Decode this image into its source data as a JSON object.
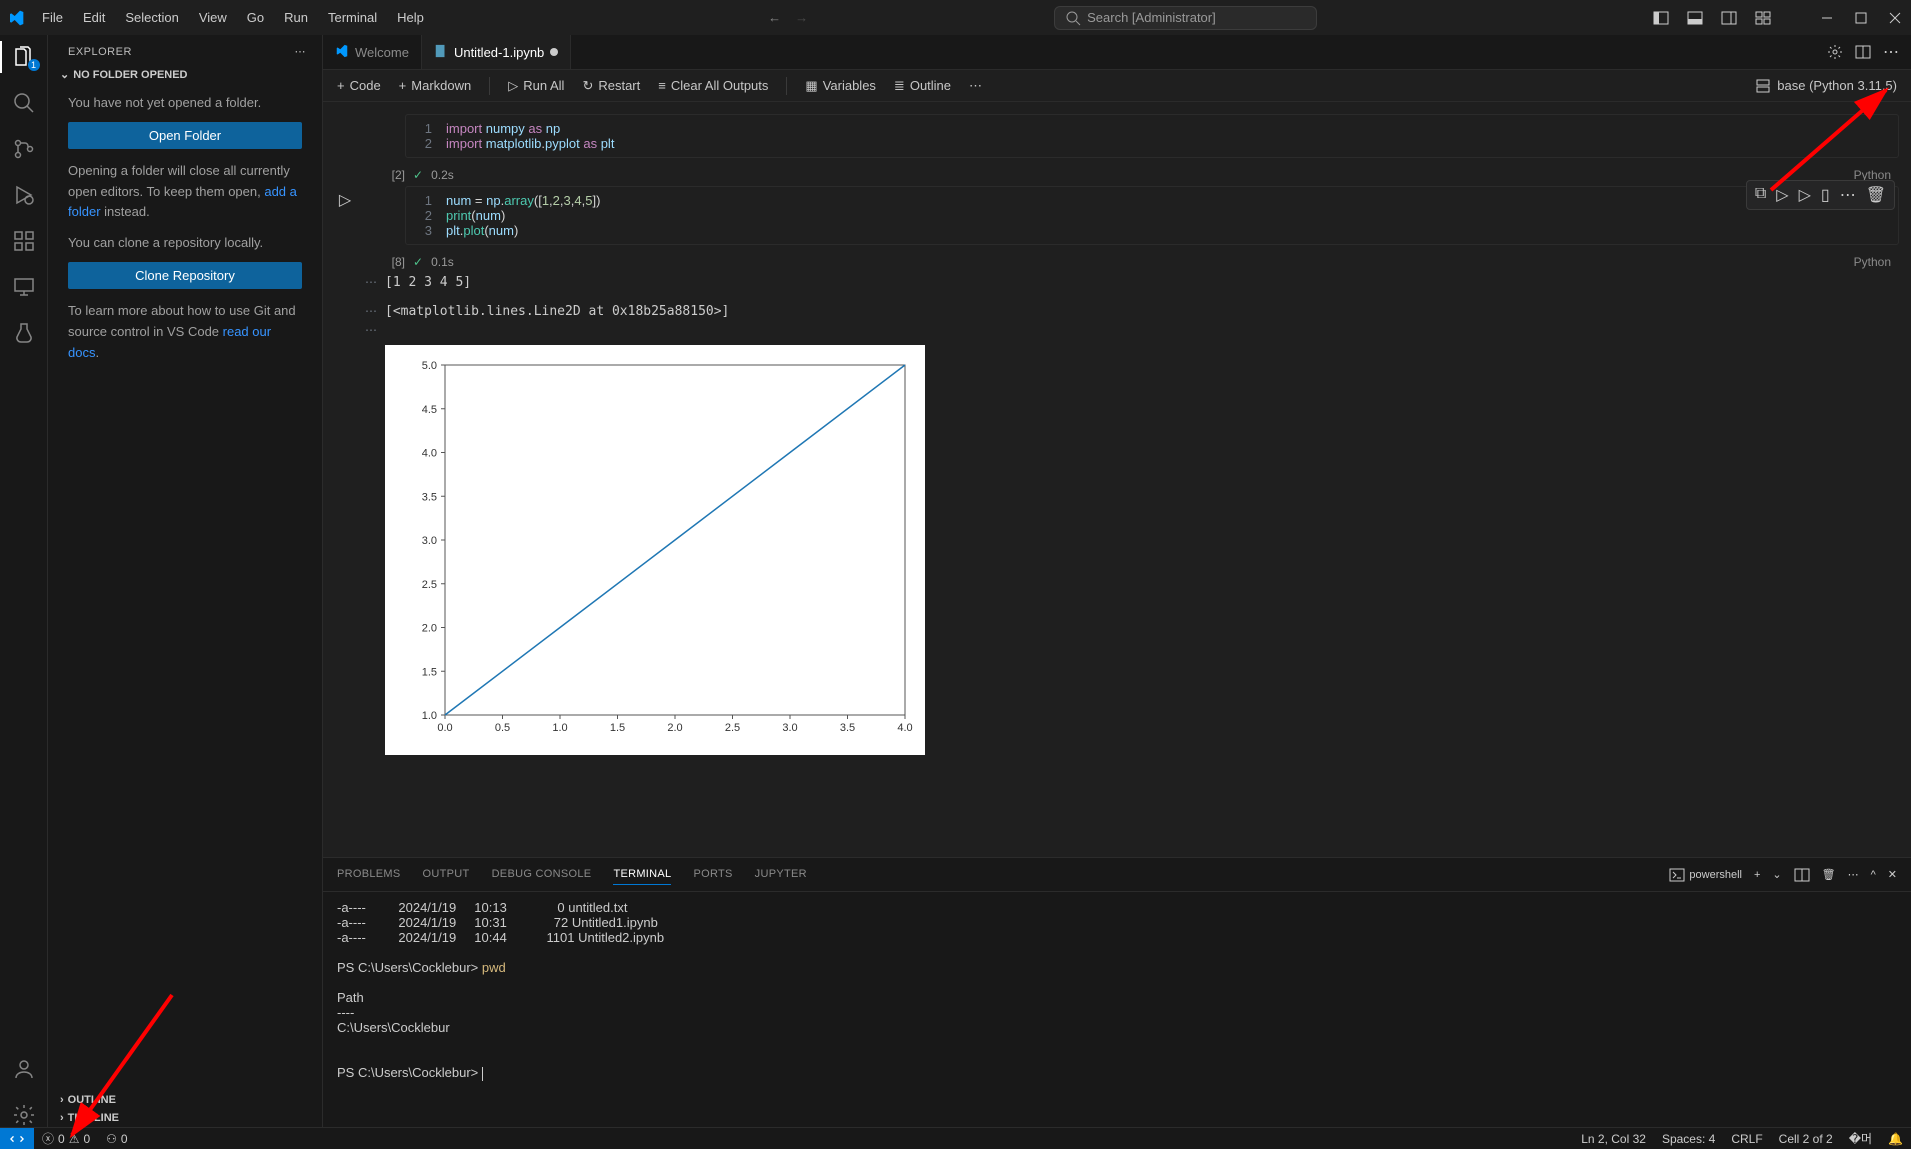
{
  "menu": [
    "File",
    "Edit",
    "Selection",
    "View",
    "Go",
    "Run",
    "Terminal",
    "Help"
  ],
  "search_placeholder": "Search [Administrator]",
  "sidebar": {
    "title": "EXPLORER",
    "section": "NO FOLDER OPENED",
    "msg_not_opened": "You have not yet opened a folder.",
    "btn_open": "Open Folder",
    "msg_close_editors_1": "Opening a folder will close all currently open editors. To keep them open, ",
    "link_add_folder": "add a folder",
    "msg_close_editors_2": " instead.",
    "msg_clone": "You can clone a repository locally.",
    "btn_clone": "Clone Repository",
    "msg_learn_1": "To learn more about how to use Git and source control in VS Code ",
    "link_docs": "read our docs",
    "msg_learn_2": ".",
    "outline_lbl": "OUTLINE",
    "timeline_lbl": "TIMELINE"
  },
  "tabs": [
    {
      "label": "Welcome",
      "active": false
    },
    {
      "label": "Untitled-1.ipynb",
      "active": true,
      "dirty": true
    }
  ],
  "nb_toolbar": {
    "code": "Code",
    "markdown": "Markdown",
    "runall": "Run All",
    "restart": "Restart",
    "clearall": "Clear All Outputs",
    "variables": "Variables",
    "outline": "Outline",
    "kernel": "base (Python 3.11.5)"
  },
  "cells": [
    {
      "exec_count": "[2]",
      "time": "0.2s",
      "lang": "Python",
      "lines": [
        {
          "n": "1",
          "html": "<span class='kw'>import</span> <span class='id'>numpy</span> <span class='kw'>as</span> <span class='id'>np</span>"
        },
        {
          "n": "2",
          "html": "<span class='kw'>import</span> <span class='id'>matplotlib</span><span class='op'>.</span><span class='id'>pyplot</span> <span class='kw'>as</span> <span class='id'>plt</span>"
        }
      ]
    },
    {
      "exec_count": "[8]",
      "time": "0.1s",
      "lang": "Python",
      "lines": [
        {
          "n": "1",
          "html": "<span class='id'>num</span> <span class='op'>=</span> <span class='id'>np</span><span class='op'>.</span><span class='fn'>array</span><span class='op'>([</span><span class='nm'>1</span><span class='op'>,</span><span class='nm'>2</span><span class='op'>,</span><span class='nm'>3</span><span class='op'>,</span><span class='nm'>4</span><span class='op'>,</span><span class='nm'>5</span><span class='op'>])</span>"
        },
        {
          "n": "2",
          "html": "<span class='fn'>print</span><span class='op'>(</span><span class='id'>num</span><span class='op'>)</span>"
        },
        {
          "n": "3",
          "html": "<span class='id'>plt</span><span class='op'>.</span><span class='fn'>plot</span><span class='op'>(</span><span class='id'>num</span><span class='op'>)</span>"
        }
      ],
      "outputs": [
        "[1 2 3 4 5]",
        "[<matplotlib.lines.Line2D at 0x18b25a88150>]"
      ]
    }
  ],
  "chart_data": {
    "type": "line",
    "x": [
      0,
      1,
      2,
      3,
      4
    ],
    "y": [
      1,
      2,
      3,
      4,
      5
    ],
    "xlabel": "",
    "ylabel": "",
    "xticks": [
      "0.0",
      "0.5",
      "1.0",
      "1.5",
      "2.0",
      "2.5",
      "3.0",
      "3.5",
      "4.0"
    ],
    "yticks": [
      "1.0",
      "1.5",
      "2.0",
      "2.5",
      "3.0",
      "3.5",
      "4.0",
      "4.5",
      "5.0"
    ],
    "xlim": [
      0,
      4
    ],
    "ylim": [
      1,
      5
    ],
    "color": "#1f77b4"
  },
  "panel": {
    "tabs": [
      "PROBLEMS",
      "OUTPUT",
      "DEBUG CONSOLE",
      "TERMINAL",
      "PORTS",
      "JUPYTER"
    ],
    "active": "TERMINAL",
    "shell_name": "powershell",
    "terminal_lines": [
      "-a----         2024/1/19     10:13              0 untitled.txt",
      "-a----         2024/1/19     10:31             72 Untitled1.ipynb",
      "-a----         2024/1/19     10:44           1101 Untitled2.ipynb",
      "",
      {
        "prompt": "PS C:\\Users\\Cocklebur> ",
        "cmd": "pwd"
      },
      "",
      "Path",
      "----",
      "C:\\Users\\Cocklebur",
      "",
      "",
      {
        "prompt": "PS C:\\Users\\Cocklebur> ",
        "cmd": ""
      }
    ]
  },
  "statusbar": {
    "errors": "0",
    "warnings": "0",
    "ports": "0",
    "ln_col": "Ln 2, Col 32",
    "spaces": "Spaces: 4",
    "eol": "CRLF",
    "cell": "Cell 2 of 2"
  }
}
